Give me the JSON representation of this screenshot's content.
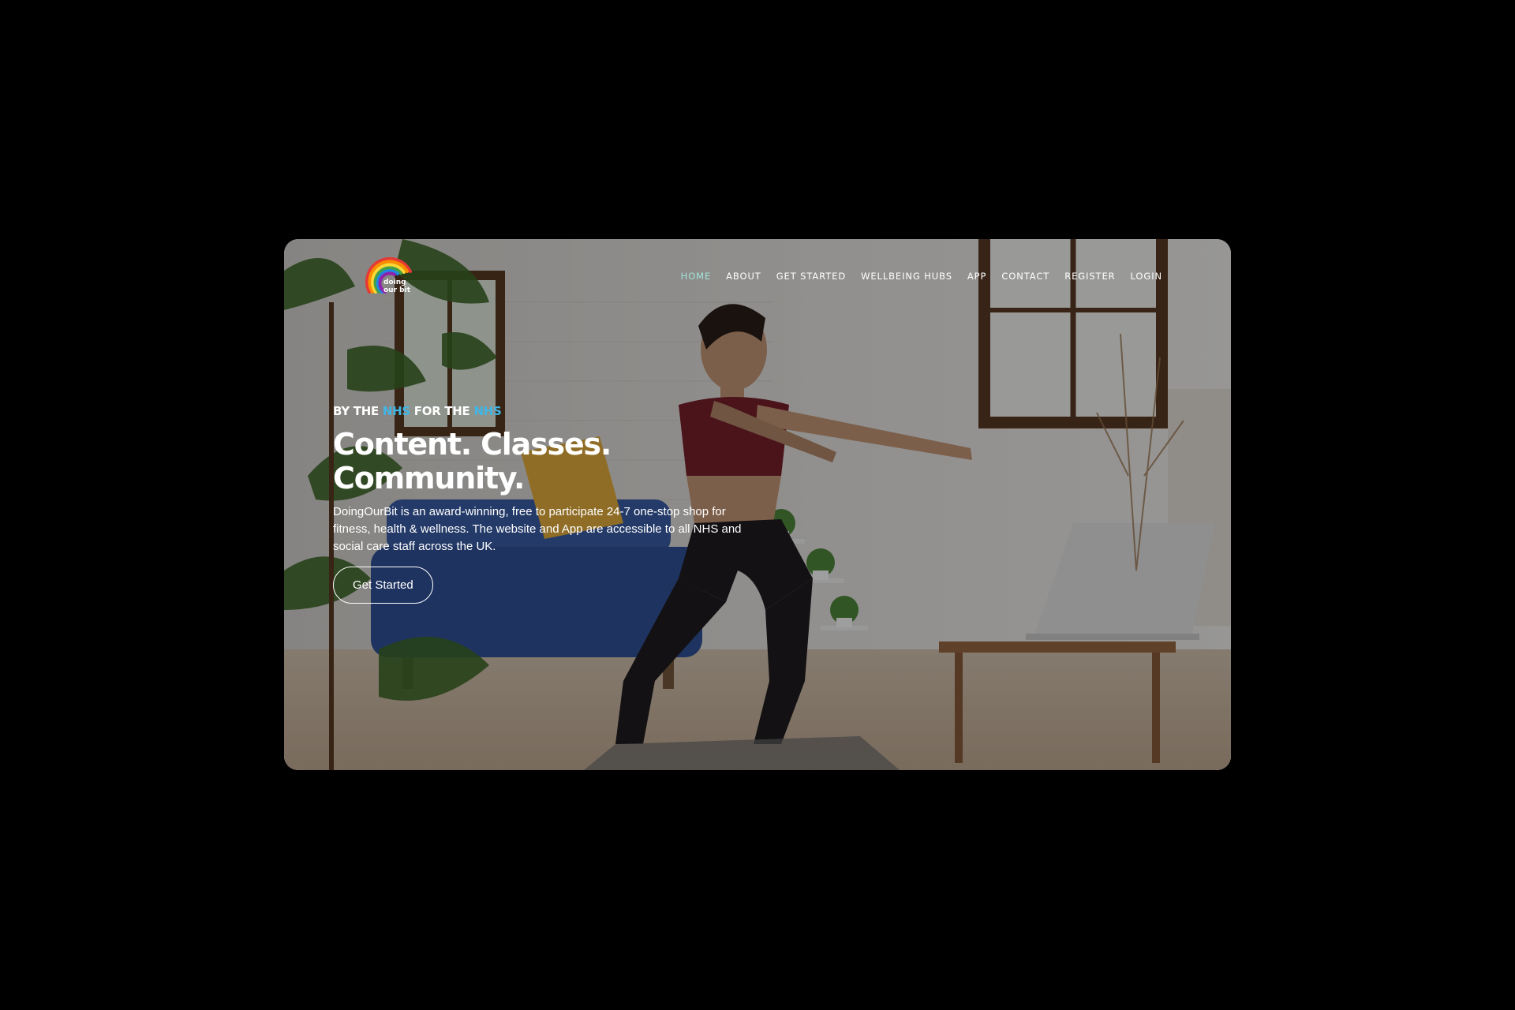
{
  "site": {
    "logo_text_line1": "doing",
    "logo_text_line2": "our bit"
  },
  "nav": {
    "items": [
      {
        "label": "HOME",
        "active": true
      },
      {
        "label": "ABOUT",
        "active": false
      },
      {
        "label": "GET STARTED",
        "active": false
      },
      {
        "label": "WELLBEING HUBS",
        "active": false
      },
      {
        "label": "APP",
        "active": false
      },
      {
        "label": "CONTACT",
        "active": false
      },
      {
        "label": "REGISTER",
        "active": false
      },
      {
        "label": "LOGIN",
        "active": false
      }
    ],
    "active_color": "#9fe3d6"
  },
  "hero": {
    "tagline_prefix": "BY THE ",
    "tagline_nhs_1": "NHS",
    "tagline_middle": " FOR THE ",
    "tagline_nhs_2": "NHS",
    "headline_line1": "Content. Classes.",
    "headline_line2": "Community.",
    "description": "DoingOurBit is an award-winning, free to participate 24-7 one-stop shop for fitness, health & wellness. The website and App are accessible to all NHS and social care staff across the UK.",
    "cta_label": "Get Started",
    "accent_color": "#41b6e6"
  }
}
